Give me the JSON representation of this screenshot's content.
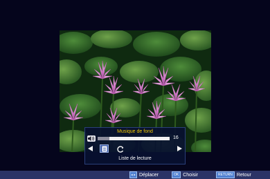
{
  "music_panel": {
    "title": "Musique de fond",
    "volume": 16,
    "volume_fraction": 0.16,
    "caption": "Liste de lecture",
    "icons": {
      "speaker": "speaker-icon",
      "playlist": "playlist-icon",
      "repeat": "repeat-icon",
      "left": "arrow-left-icon",
      "right": "arrow-right-icon"
    }
  },
  "hint_bar": {
    "move_label": "Déplacer",
    "ok_key": "OK",
    "ok_label": "Choisir",
    "return_key": "RETURN",
    "return_label": "Retour"
  },
  "colors": {
    "background": "#05051c",
    "panel_title": "#f0c800",
    "hint_bar": "#2b3366",
    "key": "#4f7fd0"
  }
}
